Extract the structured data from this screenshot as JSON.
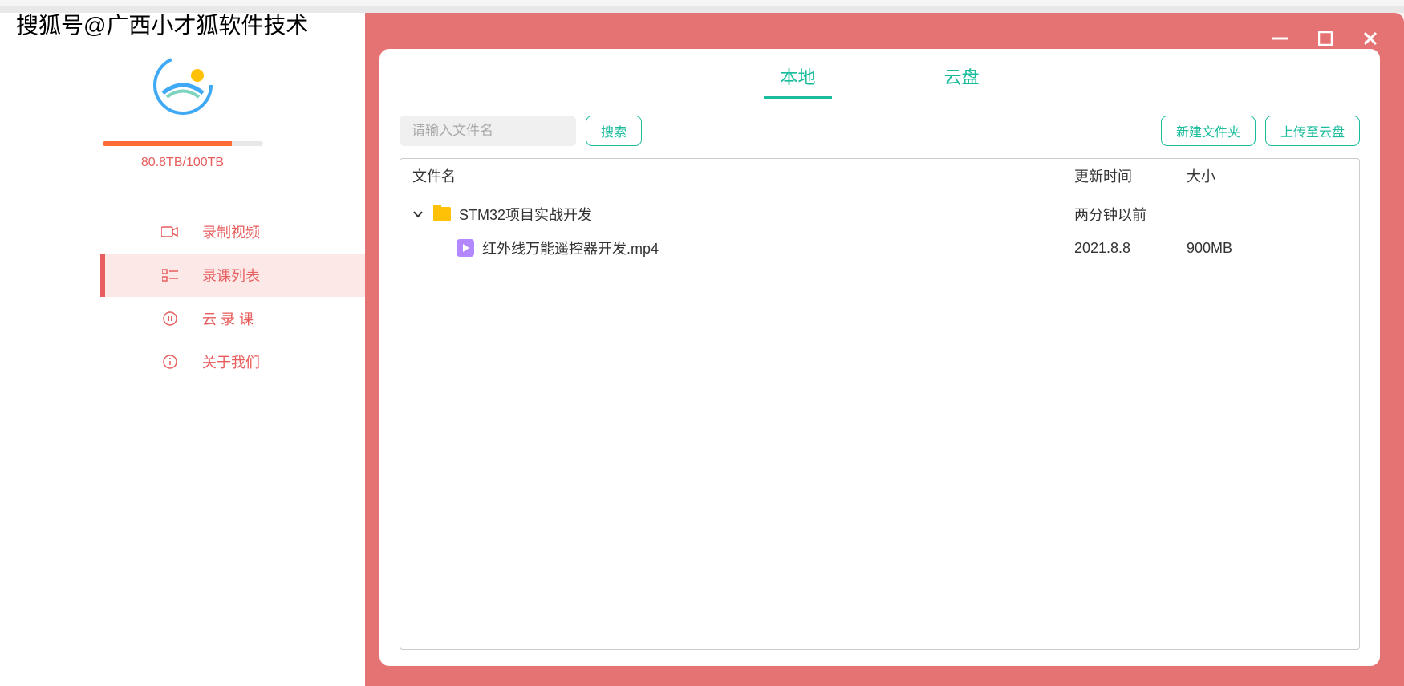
{
  "watermark": "搜狐号@广西小才狐软件技术",
  "storage": {
    "text": "80.8TB/100TB",
    "percent": 80.8
  },
  "sidebar": {
    "items": [
      {
        "label": "录制视频",
        "icon": "video-camera-icon"
      },
      {
        "label": "录课列表",
        "icon": "course-list-icon"
      },
      {
        "label": "云 录 课",
        "icon": "cloud-record-icon"
      },
      {
        "label": "关于我们",
        "icon": "info-icon"
      }
    ]
  },
  "tabs": {
    "local": "本地",
    "cloud": "云盘"
  },
  "toolbar": {
    "search_placeholder": "请输入文件名",
    "search_btn": "搜索",
    "new_folder_btn": "新建文件夹",
    "upload_btn": "上传至云盘"
  },
  "table": {
    "headers": {
      "name": "文件名",
      "time": "更新时间",
      "size": "大小"
    },
    "rows": [
      {
        "type": "folder",
        "name": "STM32项目实战开发",
        "time": "两分钟以前",
        "size": "",
        "expanded": true
      },
      {
        "type": "video",
        "name": "红外线万能遥控器开发.mp4",
        "time": "2021.8.8",
        "size": "900MB",
        "indent": true
      }
    ]
  }
}
